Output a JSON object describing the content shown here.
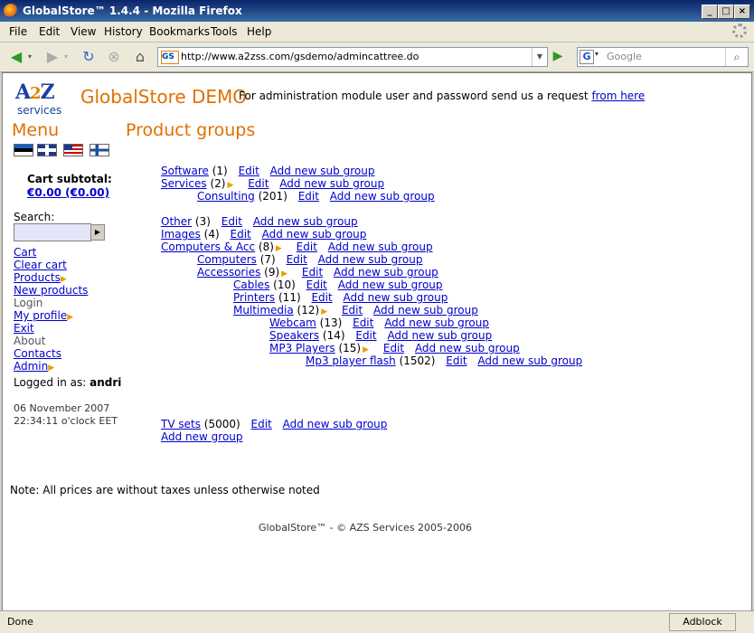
{
  "window": {
    "title": "GlobalStore™ 1.4.4 - Mozilla Firefox"
  },
  "menu": {
    "file": "File",
    "edit": "Edit",
    "view": "View",
    "history": "History",
    "bookmarks": "Bookmarks",
    "tools": "Tools",
    "help": "Help"
  },
  "nav": {
    "url": "http://www.a2zss.com/gsdemo/admincattree.do",
    "search_placeholder": "Google"
  },
  "header": {
    "logo_a": "A",
    "logo_2": "2",
    "logo_z": "Z",
    "logo_sub": "services",
    "brand": "GlobalStore DEMO",
    "admin_msg": "For administration module user and password send us a request",
    "admin_link": "from here"
  },
  "sidebar": {
    "menu_title": "Menu",
    "cart_subtotal_label": "Cart subtotal:",
    "cart_subtotal_value": "€0.00 (€0.00)",
    "search_label": "Search:",
    "items": [
      "Cart",
      "Clear cart",
      "Products",
      "New products",
      "Login",
      "My profile",
      "Exit",
      "About",
      "Contacts",
      "Admin"
    ],
    "logged_label": "Logged in as:",
    "logged_user": "andri",
    "date": "06 November 2007",
    "time": "22:34:11 o'clock EET"
  },
  "main": {
    "title": "Product groups",
    "edit": "Edit",
    "add_sub": "Add new sub group",
    "add_group": "Add new group",
    "groups": [
      {
        "name": "Software",
        "count": "(1)"
      },
      {
        "name": "Services",
        "count": "(2)"
      },
      {
        "name": "Consulting",
        "count": "(201)"
      },
      {
        "name": "Other",
        "count": "(3)"
      },
      {
        "name": "Images",
        "count": "(4)"
      },
      {
        "name": "Computers & Acc",
        "count": "(8)"
      },
      {
        "name": "Computers",
        "count": "(7)"
      },
      {
        "name": "Accessories",
        "count": "(9)"
      },
      {
        "name": "Cables",
        "count": "(10)"
      },
      {
        "name": "Printers",
        "count": "(11)"
      },
      {
        "name": "Multimedia",
        "count": "(12)"
      },
      {
        "name": "Webcam",
        "count": "(13)"
      },
      {
        "name": "Speakers",
        "count": "(14)"
      },
      {
        "name": "MP3 Players",
        "count": "(15)"
      },
      {
        "name": "Mp3 player flash",
        "count": "(1502)"
      },
      {
        "name": "TV sets",
        "count": "(5000)"
      }
    ]
  },
  "footer": {
    "note": "Note: All prices are without taxes unless otherwise noted",
    "copyright": "GlobalStore™ - © AZS Services 2005-2006"
  },
  "status": {
    "text": "Done",
    "adblock": "Adblock"
  }
}
